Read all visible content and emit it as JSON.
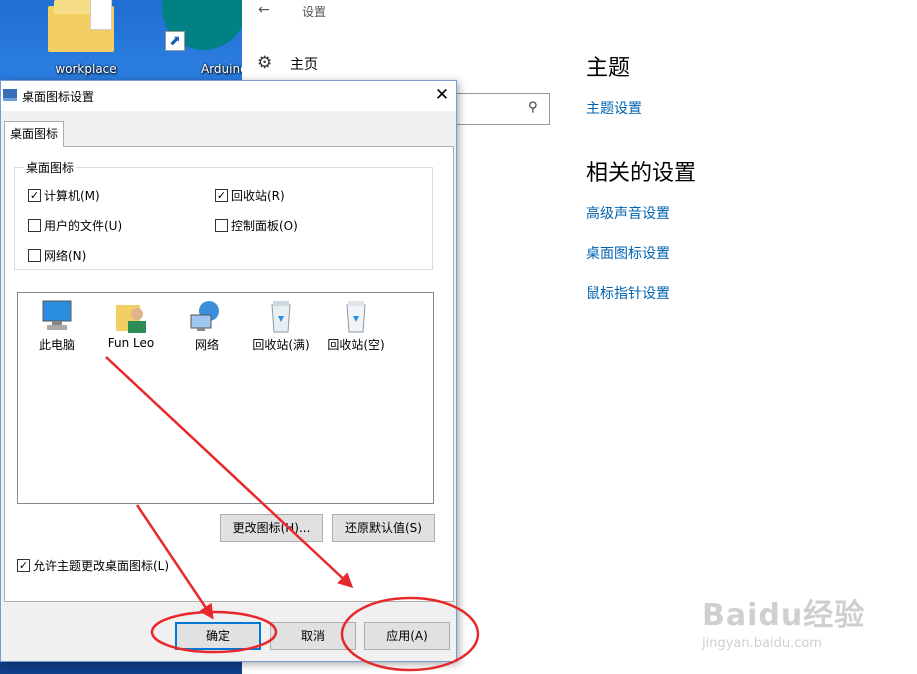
{
  "desktop": {
    "icons": [
      {
        "label": "workplace"
      },
      {
        "label": "Arduino"
      }
    ]
  },
  "settings": {
    "title": "设置",
    "home_label": "主页",
    "theme_heading": "主题",
    "theme_settings_link": "主题设置",
    "related_heading": "相关的设置",
    "links": [
      "高级声音设置",
      "桌面图标设置",
      "鼠标指针设置"
    ]
  },
  "dialog": {
    "title": "桌面图标设置",
    "tab_label": "桌面图标",
    "group_label": "桌面图标",
    "checkboxes": [
      {
        "label": "计算机(M)",
        "checked": true
      },
      {
        "label": "回收站(R)",
        "checked": true
      },
      {
        "label": "用户的文件(U)",
        "checked": false
      },
      {
        "label": "控制面板(O)",
        "checked": false
      },
      {
        "label": "网络(N)",
        "checked": false
      }
    ],
    "icons": [
      {
        "label": "此电脑"
      },
      {
        "label": "Fun Leo"
      },
      {
        "label": "网络"
      },
      {
        "label": "回收站(满)"
      },
      {
        "label": "回收站(空)"
      }
    ],
    "change_icon_label": "更改图标(H)...",
    "restore_default_label": "还原默认值(S)",
    "allow_theme_label": "允许主题更改桌面图标(L)",
    "allow_theme_checked": true,
    "ok_label": "确定",
    "cancel_label": "取消",
    "apply_label": "应用(A)"
  },
  "watermark": {
    "brand": "Baidu经验",
    "url": "jingyan.baidu.com"
  },
  "colors": {
    "link": "#0063b1",
    "annotation": "#e8292b",
    "focus_border": "#0078d7"
  }
}
